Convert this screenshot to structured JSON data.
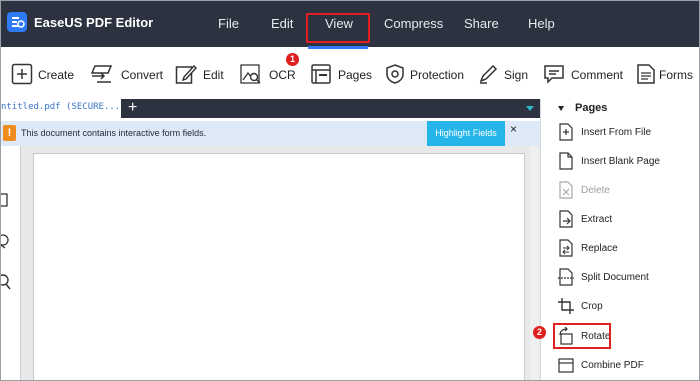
{
  "app": {
    "title": "EaseUS PDF Editor",
    "logo_icon": "easeus-logo-icon"
  },
  "menu": [
    "File",
    "Edit",
    "View",
    "Compress",
    "Share",
    "Help"
  ],
  "toolbar": {
    "items": [
      {
        "label": "Create",
        "icon": "plus-icon"
      },
      {
        "label": "Convert",
        "icon": "convert-icon"
      },
      {
        "label": "Edit",
        "icon": "edit-icon"
      },
      {
        "label": "OCR",
        "icon": "ocr-icon"
      },
      {
        "label": "Pages",
        "icon": "pages-icon",
        "active": true
      },
      {
        "label": "Protection",
        "icon": "shield-icon"
      },
      {
        "label": "Sign",
        "icon": "pen-icon"
      },
      {
        "label": "Comment",
        "icon": "comment-icon"
      },
      {
        "label": "Forms",
        "icon": "form-icon"
      }
    ],
    "highlight_color": "#e02020",
    "active_underline_color": "#2f7bf5"
  },
  "annotations": {
    "step1": "1",
    "step2": "2"
  },
  "tabs": {
    "doc_tab_label": "ntitled.pdf (SECURE...",
    "add_tab": "+"
  },
  "notification": {
    "text": "This document contains interactive form fields.",
    "action_label": "Highlight Fields",
    "close_label": "×",
    "icon": "!"
  },
  "pages_panel": {
    "title": "Pages",
    "items": [
      {
        "label": "Insert From File",
        "icon": "insert-file-icon",
        "enabled": true
      },
      {
        "label": "Insert Blank Page",
        "icon": "insert-blank-icon",
        "enabled": true
      },
      {
        "label": "Delete",
        "icon": "delete-page-icon",
        "enabled": false
      },
      {
        "label": "Extract",
        "icon": "extract-icon",
        "enabled": true
      },
      {
        "label": "Replace",
        "icon": "replace-icon",
        "enabled": true
      },
      {
        "label": "Split Document",
        "icon": "split-icon",
        "enabled": true
      },
      {
        "label": "Crop",
        "icon": "crop-icon",
        "enabled": true
      },
      {
        "label": "Rotate",
        "icon": "rotate-icon",
        "enabled": true
      },
      {
        "label": "Combine PDF",
        "icon": "combine-icon",
        "enabled": true
      }
    ]
  },
  "colors": {
    "titlebar": "#2c3240",
    "notice_bg": "#dde9f6",
    "highlight_button": "#26b5e8",
    "warning": "#f08c1e"
  }
}
